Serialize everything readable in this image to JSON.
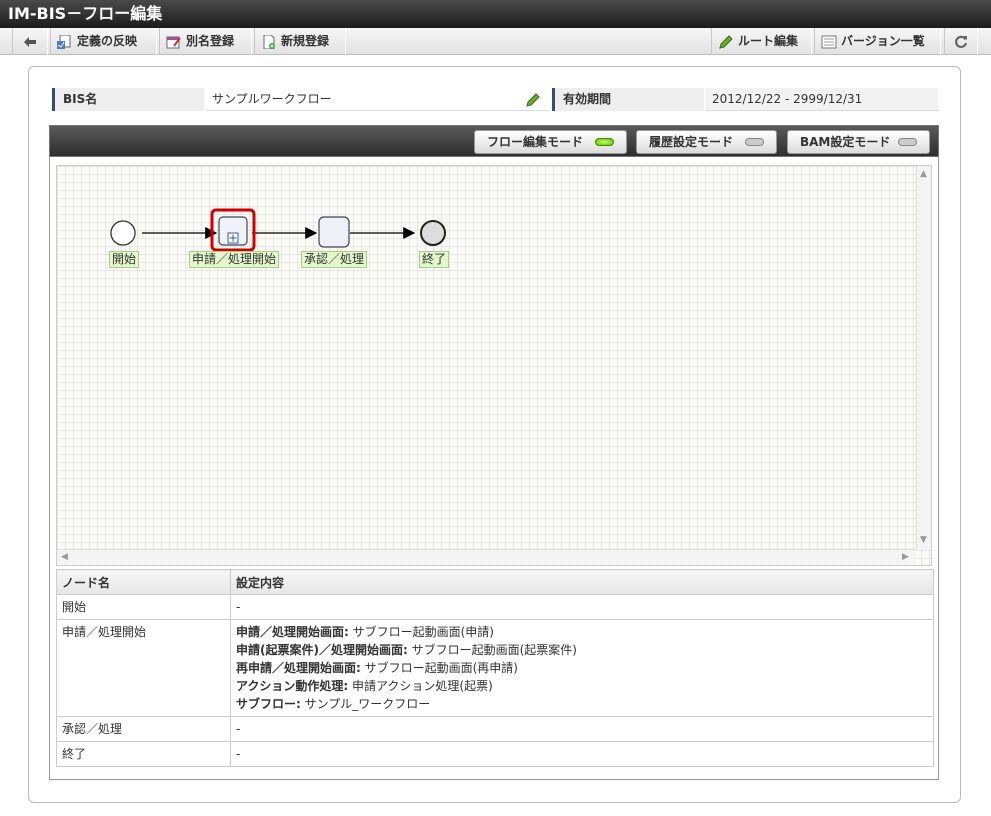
{
  "window": {
    "title": "IM-BIS－フロー編集"
  },
  "toolbar": {
    "back_icon": "arrow-left-icon",
    "apply_label": "定義の反映",
    "alias_label": "別名登録",
    "new_label": "新規登録",
    "route_edit_label": "ルート編集",
    "version_list_label": "バージョン一覧",
    "reload_icon": "reload-icon"
  },
  "info": {
    "bis_name_label": "BIS名",
    "bis_name_value": "サンプルワークフロー",
    "period_label": "有効期間",
    "period_value": "2012/12/22 - 2999/12/31"
  },
  "modes": [
    {
      "label": "フロー編集モード",
      "active": true
    },
    {
      "label": "履歴設定モード",
      "active": false
    },
    {
      "label": "BAM設定モード",
      "active": false
    }
  ],
  "flow": {
    "nodes": [
      {
        "label": "開始",
        "kind": "start"
      },
      {
        "label": "申請／処理開始",
        "kind": "subprocess",
        "selected": true
      },
      {
        "label": "承認／処理",
        "kind": "task"
      },
      {
        "label": "終了",
        "kind": "end"
      }
    ]
  },
  "table": {
    "headers": [
      "ノード名",
      "設定内容"
    ],
    "rows": [
      {
        "name": "開始",
        "lines": [
          {
            "key": "",
            "value": "-"
          }
        ]
      },
      {
        "name": "申請／処理開始",
        "lines": [
          {
            "key": "申請／処理開始画面:",
            "value": " サブフロー起動画面(申請)"
          },
          {
            "key": "申請(起票案件)／処理開始画面:",
            "value": " サブフロー起動画面(起票案件)"
          },
          {
            "key": "再申請／処理開始画面:",
            "value": " サブフロー起動画面(再申請)"
          },
          {
            "key": "アクション動作処理:",
            "value": " 申請アクション処理(起票)"
          },
          {
            "key": "サブフロー:",
            "value": " サンプル_ワークフロー"
          }
        ]
      },
      {
        "name": "承認／処理",
        "lines": [
          {
            "key": "",
            "value": "-"
          }
        ]
      },
      {
        "name": "終了",
        "lines": [
          {
            "key": "",
            "value": "-"
          }
        ]
      }
    ]
  },
  "colors": {
    "accent_bar": "#3a4a70",
    "lamp_on": "#58c000",
    "selected_border": "#d00000",
    "node_label_bg": "#e4f7cc"
  }
}
